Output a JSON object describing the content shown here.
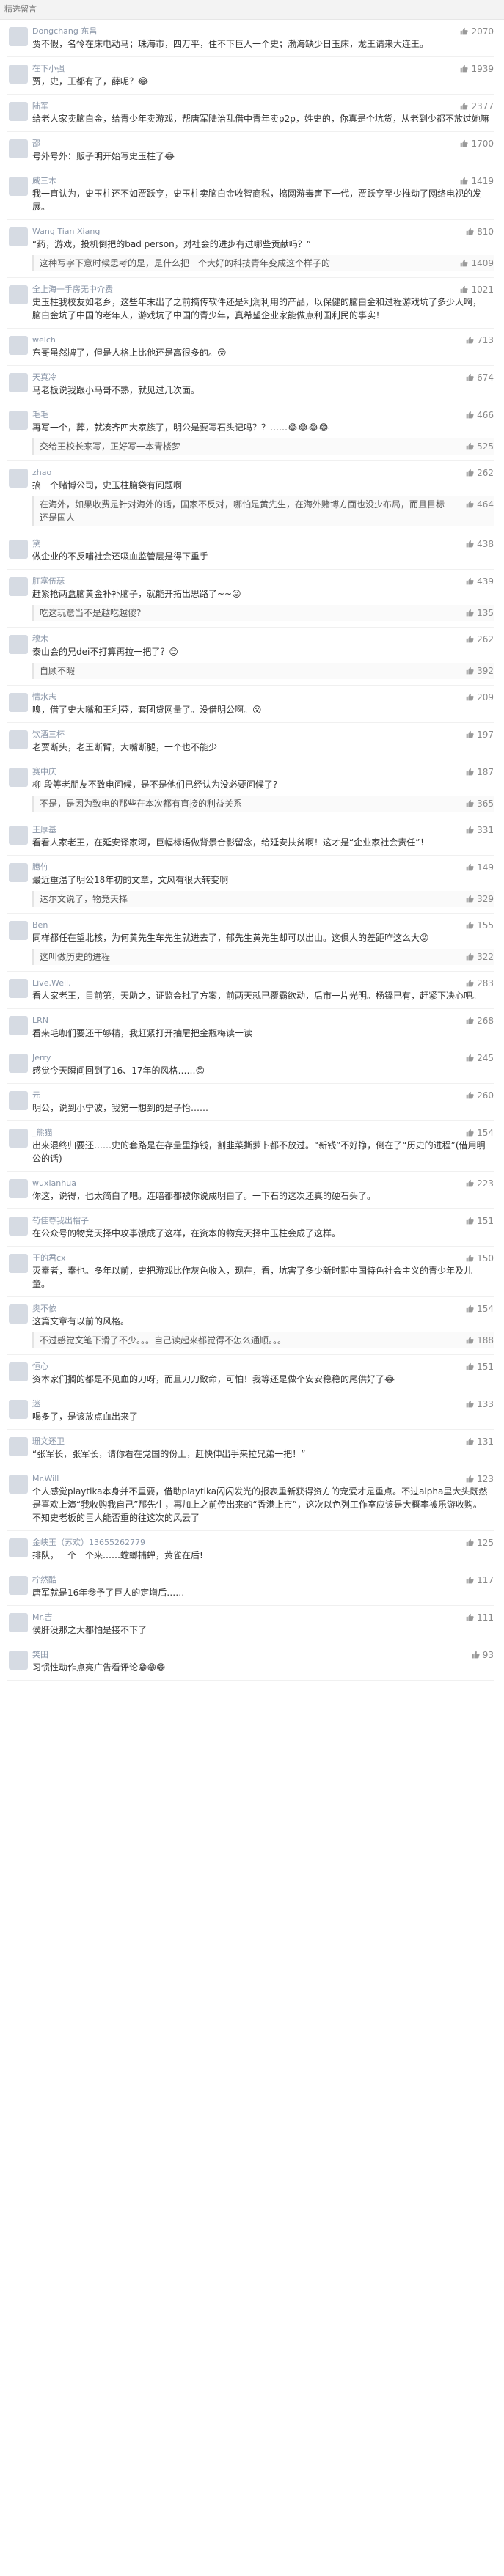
{
  "header": {
    "title": "精选留言"
  },
  "comments": [
    {
      "user": "Dongchang 东昌",
      "likes": "2070",
      "text": "贾不假，名怜在床电动马；珠海市，四万平，住不下巨人一个史；渤海缺少日玉床，龙王请来大连王。",
      "reply": "",
      "reply_likes": ""
    },
    {
      "user": "在下小强",
      "likes": "1939",
      "text": "贾，史，王都有了，薛呢？😂",
      "reply": "",
      "reply_likes": ""
    },
    {
      "user": "陆军",
      "likes": "2377",
      "text": "给老人家卖脑白金，给青少年卖游戏，帮唐军陆治乱借中青年卖p2p，姓史的，你真是个坑货，从老到少都不放过她嘛",
      "reply": "",
      "reply_likes": ""
    },
    {
      "user": "邵",
      "likes": "1700",
      "text": "号外号外：贩子明开始写史玉柱了😂",
      "reply": "",
      "reply_likes": ""
    },
    {
      "user": "威三木",
      "likes": "1419",
      "text": "我一直认为，史玉柱还不如贾跃亨，史玉柱卖脑白金收智商税，搞网游毒害下一代，贾跃亨至少推动了网络电视的发展。",
      "reply": "",
      "reply_likes": ""
    },
    {
      "user": "Wang Tian Xiang",
      "likes": "810",
      "text": "“药，游戏，投机倒把的bad person，对社会的进步有过哪些贡献吗？”",
      "reply": "这种写字下意时候思考的是，是什么把一个大好的科技青年变成这个样子的",
      "reply_likes": "1409"
    },
    {
      "user": "全上海一手房无中介费",
      "likes": "1021",
      "text": "史玉柱我校友如老乡，这些年末出了之前搞传软件还是利润利用的产品，以保健的脑白金和过程游戏坑了多少人啊，脑白金坑了中国的老年人，游戏坑了中国的青少年，真希望企业家能做点利国利民的事实！",
      "reply": "",
      "reply_likes": ""
    },
    {
      "user": "welch",
      "likes": "713",
      "text": "东哥虽然牌了，但是人格上比他还是高很多的。😵",
      "reply": "",
      "reply_likes": ""
    },
    {
      "user": "天真冷",
      "likes": "674",
      "text": "马老板说我跟小马哥不熟，就见过几次面。",
      "reply": "",
      "reply_likes": ""
    },
    {
      "user": "毛毛",
      "likes": "466",
      "text": "再写一个，葬，就凑齐四大家族了，明公是要写石头记吗？？……😂😂😂😂",
      "reply": "交给王校长来写，正好写一本青楼梦",
      "reply_likes": "525"
    },
    {
      "user": "zhao",
      "likes": "262",
      "text": "搞一个赌博公司，史玉柱脑袋有问题啊",
      "reply": "在海外，如果收费是针对海外的话，国家不反对，哪怕是黄先生，在海外赌博方面也没少布局，而且目标还是国人",
      "reply_likes": "464"
    },
    {
      "user": "黛",
      "likes": "438",
      "text": "做企业的不反哺社会还吸血监管层是得下重手",
      "reply": "",
      "reply_likes": ""
    },
    {
      "user": "肛塞伍瑟",
      "likes": "439",
      "text": "赶紧抢两盒脑黄金补补脑子，就能开拓出思路了~~😜",
      "reply": "吃这玩意当不是越吃越傻?",
      "reply_likes": "135"
    },
    {
      "user": "穆木",
      "likes": "262",
      "text": "泰山会的兄dei不打算再拉一把了？😊",
      "reply": "自顾不暇",
      "reply_likes": "392"
    },
    {
      "user": "情水志",
      "likes": "209",
      "text": "嗅，借了史大嘴和王利芬，套团贷网量了。没借明公啊。😵",
      "reply": "",
      "reply_likes": ""
    },
    {
      "user": "饮酒三杯",
      "likes": "197",
      "text": "老贾断头，老王断臂，大嘴断腿，一个也不能少",
      "reply": "",
      "reply_likes": ""
    },
    {
      "user": "赛中庆",
      "likes": "187",
      "text": "柳 段等老朋友不致电问候，是不是他们已经认为没必要问候了?",
      "reply": "不是，是因为致电的那些在本次都有直接的利益关系",
      "reply_likes": "365"
    },
    {
      "user": "王厚基",
      "likes": "331",
      "text": "看看人家老王，在延安译家河，巨幅标语做背景合影留念，给延安扶贫啊！这才是“企业家社会责任”！",
      "reply": "",
      "reply_likes": ""
    },
    {
      "user": "腾竹",
      "likes": "149",
      "text": "最近重温了明公18年初的文章，文风有很大转变啊",
      "reply": "达尔文说了，物竞天择",
      "reply_likes": "329"
    },
    {
      "user": "Ben",
      "likes": "155",
      "text": "同样都任在望北核，为何黄先生车先生就进去了，郁先生黄先生却可以出山。这俱人的差距咋这么大😡",
      "reply": "这叫做历史的进程",
      "reply_likes": "322"
    },
    {
      "user": "Live.Well.",
      "likes": "283",
      "text": "看人家老王，目前第，天助之，证监会批了方案，前两天就已覆霸欲动，后市一片光明。杨铎已有，赶紧下决心吧。",
      "reply": "",
      "reply_likes": ""
    },
    {
      "user": "LRN",
      "likes": "268",
      "text": "看来毛咖们要还干够精，我赶紧打开抽屉把金瓶梅读一读",
      "reply": "",
      "reply_likes": ""
    },
    {
      "user": "Jerry",
      "likes": "245",
      "text": "感觉今天瞬间回到了16、17年的风格……😊",
      "reply": "",
      "reply_likes": ""
    },
    {
      "user": "元",
      "likes": "260",
      "text": "明公，说到小宁波，我第一想到的是子怡……",
      "reply": "",
      "reply_likes": ""
    },
    {
      "user": "_熊猫",
      "likes": "154",
      "text": "出来混终归要还……史的套路是在存量里挣钱，割韭菜撕萝卜都不放过。“新钱”不好挣，倒在了“历史的进程”(借用明公的话)",
      "reply": "",
      "reply_likes": ""
    },
    {
      "user": "wuxianhua",
      "likes": "223",
      "text": "你这，说得，也太简白了吧。连暗都都被你说成明白了。一下石的这次还真的硬石头了。",
      "reply": "",
      "reply_likes": ""
    },
    {
      "user": "苟佳尊我出帽子",
      "likes": "151",
      "text": "在公众号的物竞天择中攻事饿成了这样，在资本的物竞天择中玉柱会成了这样。",
      "reply": "",
      "reply_likes": ""
    },
    {
      "user": "王的君cx",
      "likes": "150",
      "text": "灭奉者，奉也。多年以前，史把游戏比作灰色收入，现在，看，坑害了多少新时期中国特色社会主义的青少年及儿童。",
      "reply": "",
      "reply_likes": ""
    },
    {
      "user": "奥不依",
      "likes": "154",
      "text": "这篇文章有以前的风格。",
      "reply": "不过感觉文笔下滑了不少。。。自己读起来都觉得不怎么通顺。。。",
      "reply_likes": "188"
    },
    {
      "user": "恒心",
      "likes": "151",
      "text": "资本家们搁的都是不见血的刀呀，而且刀刀致命，可怕！我等还是做个安安稳稳的尾供好了😂",
      "reply": "",
      "reply_likes": ""
    },
    {
      "user": "迷",
      "likes": "133",
      "text": "喝多了，是该放点血出来了",
      "reply": "",
      "reply_likes": ""
    },
    {
      "user": "珊文还卫",
      "likes": "131",
      "text": "“张军长，张军长，请你看在党国的份上，赶快伸出手来拉兄弟一把！”",
      "reply": "",
      "reply_likes": ""
    },
    {
      "user": "Mr.Will",
      "likes": "123",
      "text": "个人感觉playtika本身并不重要，借助playtika闪闪发光的报表重新获得资方的宠爱才是重点。不过alpha里大头既然是喜欢上演“我收购我自己”那先生，再加上之前传出来的“香港上市”，这次以色列工作室应该是大概率被乐游收购。不知史老板的巨人能否重的往这次的风云了",
      "reply": "",
      "reply_likes": ""
    },
    {
      "user": "金峡玉（苏欢）13655262779",
      "likes": "125",
      "text": "排队，一个一个来……螳螂捕蝉，黄雀在后!",
      "reply": "",
      "reply_likes": ""
    },
    {
      "user": "柠然酷",
      "likes": "117",
      "text": "唐军就是16年参予了巨人的定增后……",
      "reply": "",
      "reply_likes": ""
    },
    {
      "user": "Mr.吉",
      "likes": "111",
      "text": "侯肝没那之大都怕是接不下了",
      "reply": "",
      "reply_likes": ""
    },
    {
      "user": "笑田",
      "likes": "93",
      "text": "习惯性动作点亮广告看评论😁😁😁",
      "reply": "",
      "reply_likes": ""
    }
  ]
}
